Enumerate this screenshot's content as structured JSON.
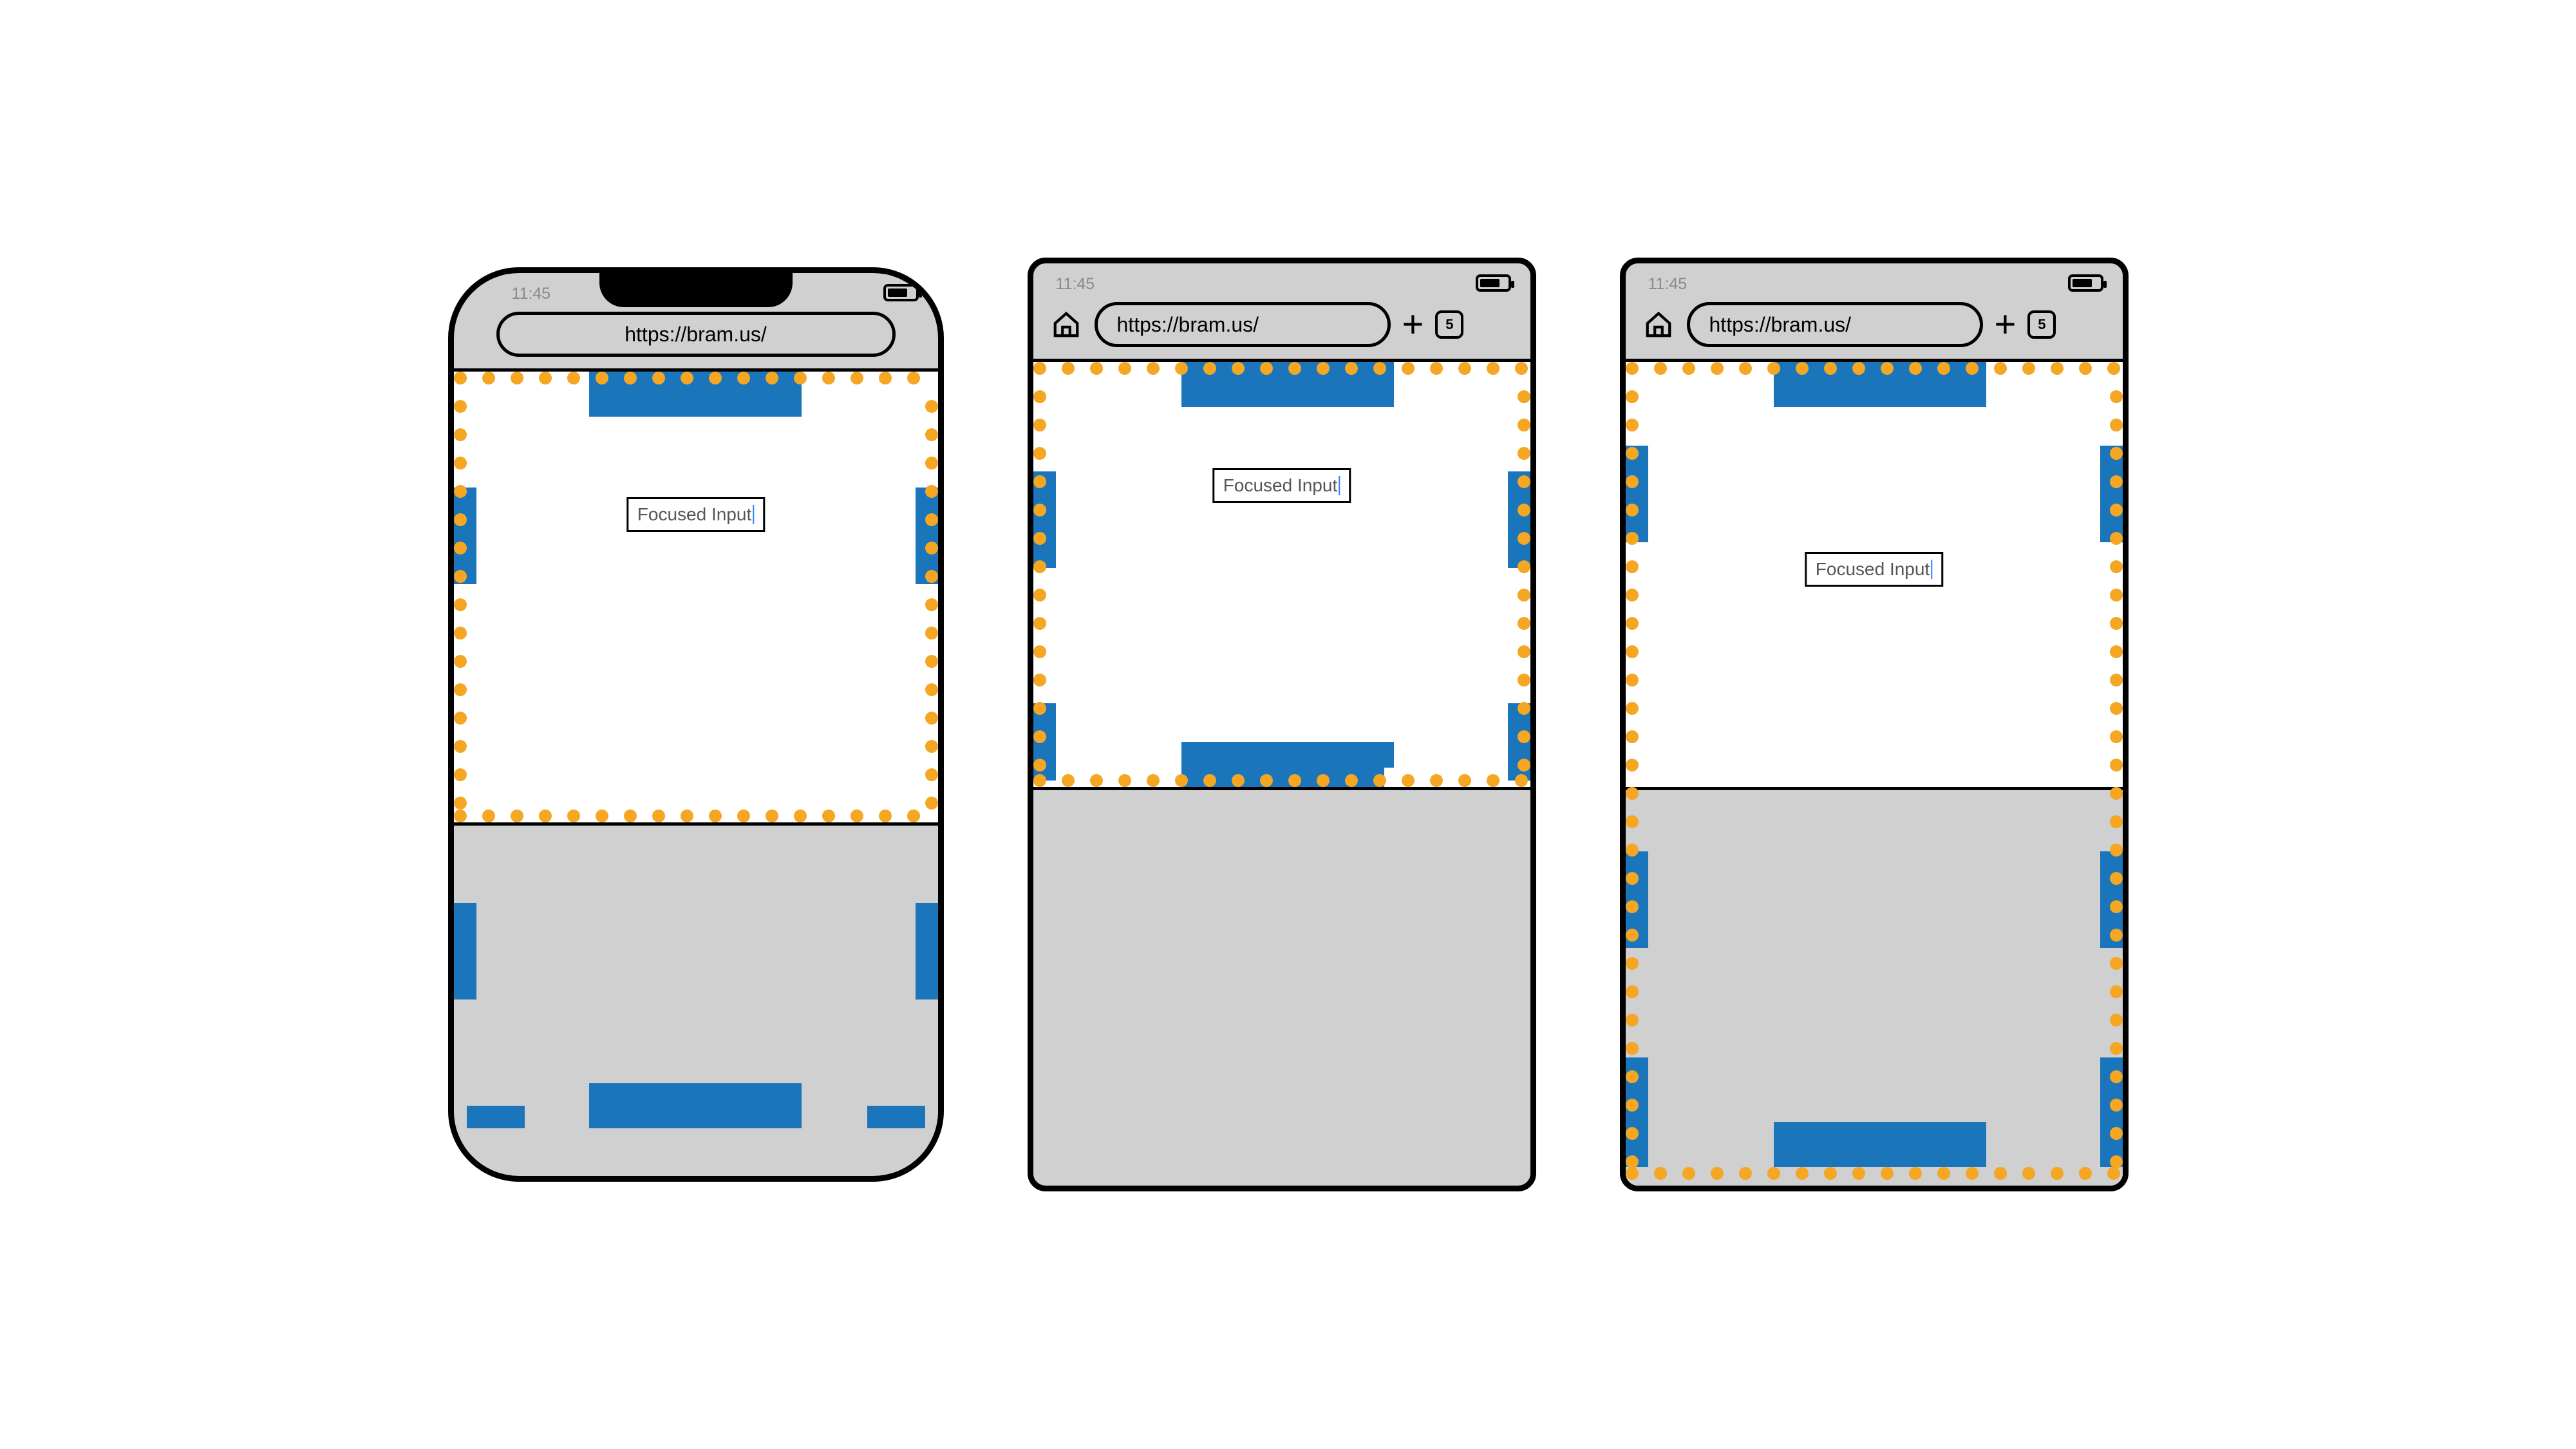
{
  "common": {
    "time": "11:45",
    "url": "https://bram.us/",
    "tab_count": "5",
    "input_text": "Focused Input"
  },
  "colors": {
    "accent_blue": "#1b75bb",
    "dot_orange": "#f5a623",
    "chrome_grey": "#d0d0d0"
  }
}
